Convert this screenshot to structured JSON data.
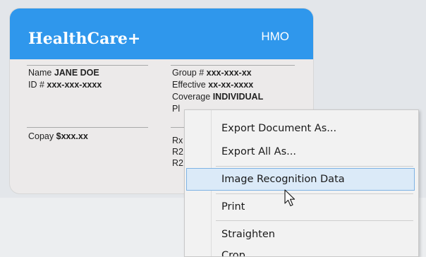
{
  "card": {
    "brand": "HealthCare+",
    "plan": "HMO",
    "name_label": "Name",
    "name_value": "JANE DOE",
    "id_label": "ID #",
    "id_value": "xxx-xxx-xxxx",
    "copay_label": "Copay",
    "copay_value": "$xxx.xx",
    "group_label": "Group #",
    "group_value": "xxx-xxx-xx",
    "effective_label": "Effective",
    "effective_value": "xx-xx-xxxx",
    "coverage_label": "Coverage",
    "coverage_value": "INDIVIDUAL",
    "pl_partial": "Pl",
    "rx_partial_1": "Rx",
    "rx_partial_2": "R2",
    "rx_partial_3": "R2"
  },
  "context_menu": {
    "items": [
      {
        "label": "Export Document As..."
      },
      {
        "label": "Export All As..."
      },
      {
        "label": "Image Recognition Data"
      },
      {
        "label": "Print"
      },
      {
        "label": "Straighten"
      },
      {
        "label": "Crop"
      }
    ],
    "highlighted_index": 2
  },
  "icons": {
    "cursor": "arrow-cursor-icon"
  },
  "colors": {
    "card_header": "#2f97ec",
    "menu_highlight": "#dbeaf8",
    "menu_highlight_border": "#7fb3e4"
  }
}
